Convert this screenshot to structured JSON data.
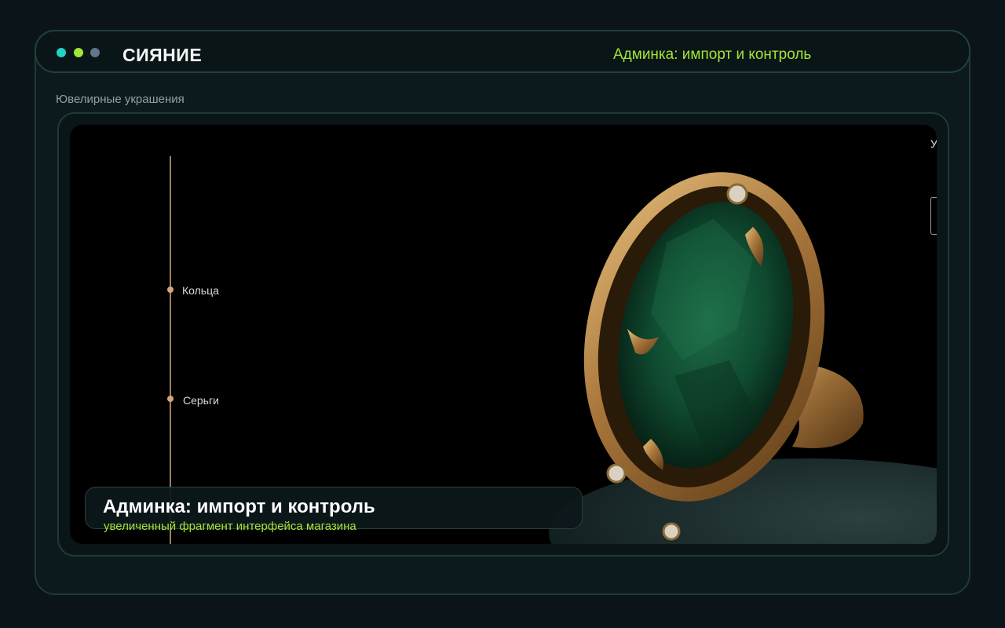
{
  "window": {
    "brand": "СИЯНИЕ",
    "header_title": "Админка: импорт и контроль"
  },
  "section": {
    "label": "Ювелирные украшения"
  },
  "preview": {
    "timeline": [
      {
        "label": "Кольца"
      },
      {
        "label": "Серьги"
      }
    ],
    "partial_text": "У",
    "image_subject": "gold ring with green gemstone"
  },
  "caption": {
    "title": "Админка: импорт и контроль",
    "subtitle": "увеличенный фрагмент интерфейса магазина"
  },
  "colors": {
    "accent": "#a3e635",
    "teal": "#22d3c5",
    "gold": "#c9a062",
    "emerald": "#0f4a30"
  },
  "icons": [
    "window-dot-teal-icon",
    "window-dot-lime-icon",
    "window-dot-grey-icon"
  ]
}
